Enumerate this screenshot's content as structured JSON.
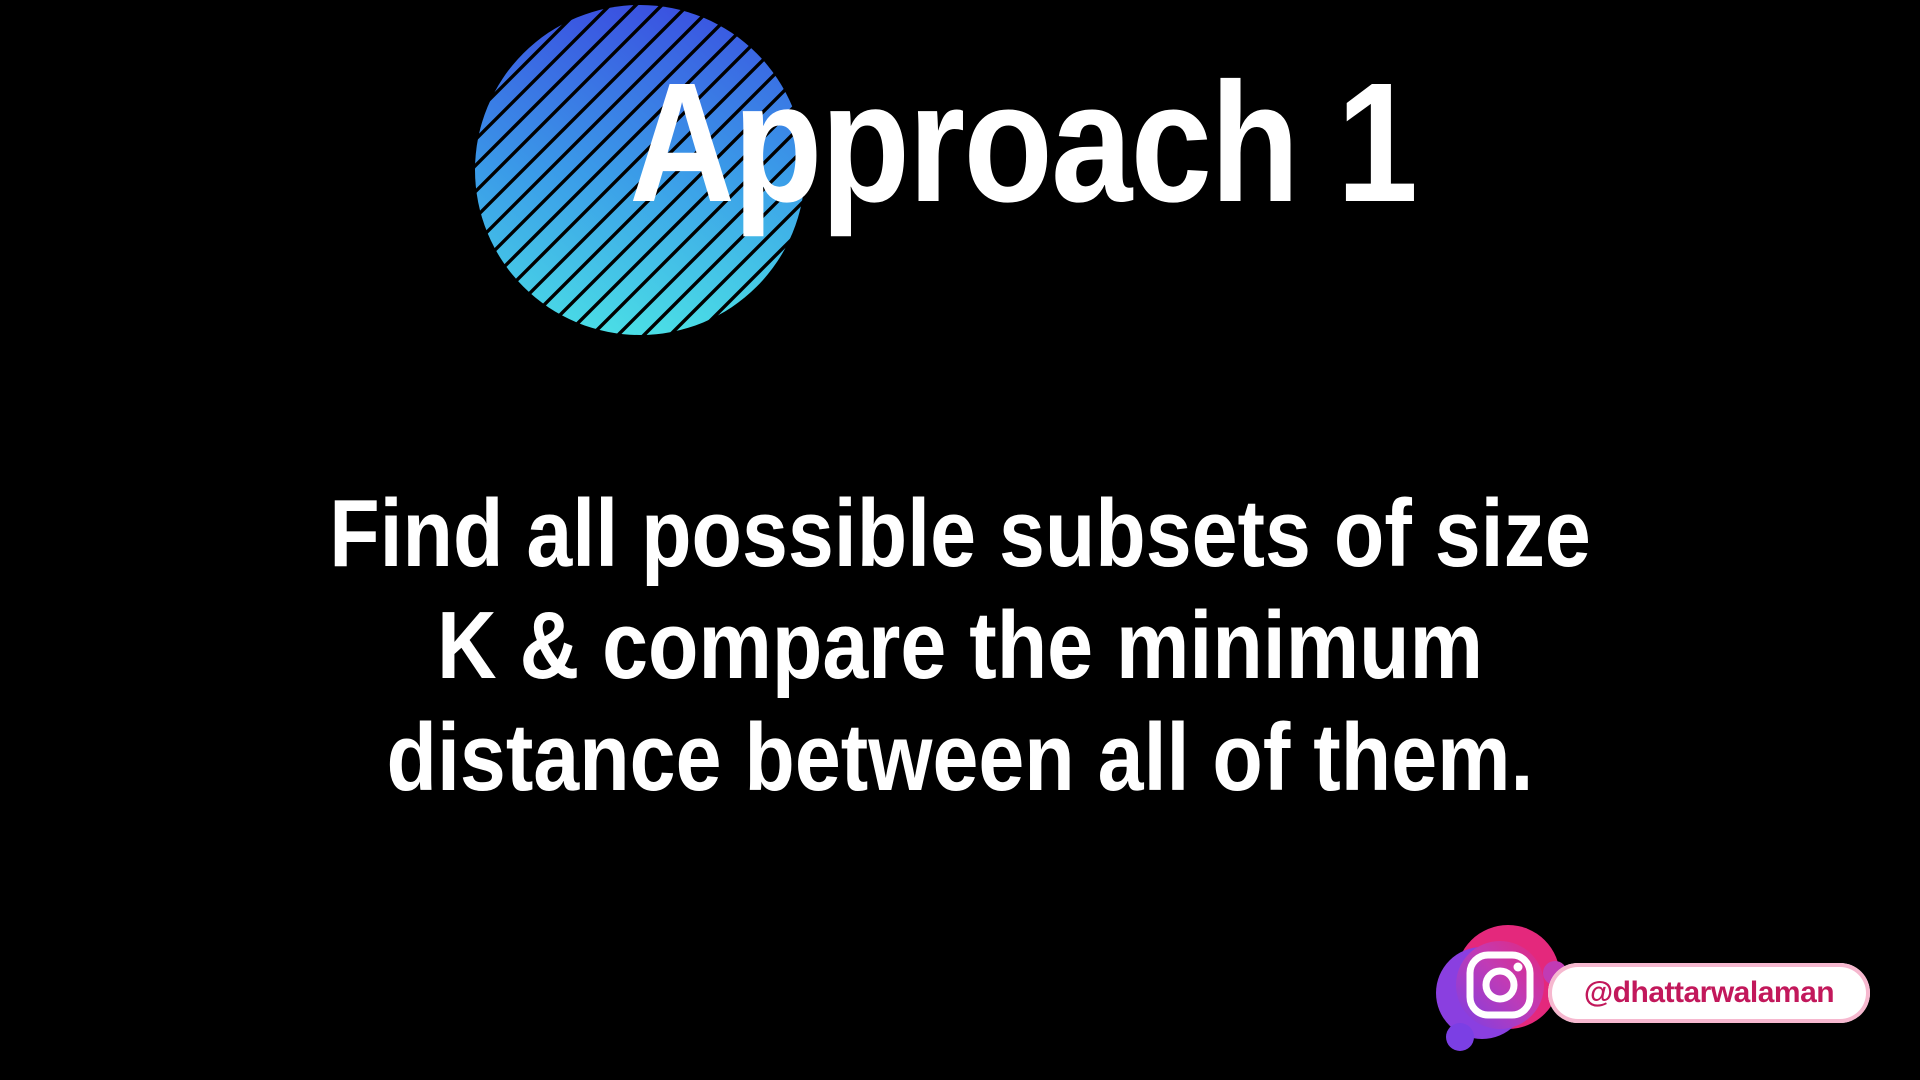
{
  "slide": {
    "title": "Approach 1",
    "body_lines": [
      "Find all possible subsets of size",
      "K & compare the minimum",
      "distance between all of them."
    ]
  },
  "footer": {
    "social_icon": "instagram-icon",
    "handle": "@dhattarwalaman"
  },
  "colors": {
    "background": "#000000",
    "text": "#ffffff",
    "circle_gradient_start": "#4be0e6",
    "circle_gradient_end": "#3a4fe0",
    "instagram_pink": "#e4287c",
    "instagram_purple": "#7b3fe4",
    "handle_text": "#c2185b"
  }
}
